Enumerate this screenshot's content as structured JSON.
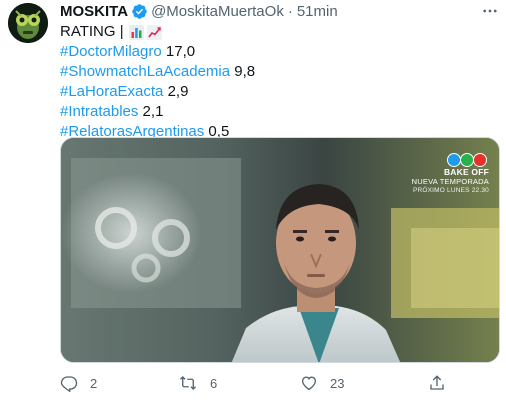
{
  "tweet": {
    "display_name": "MOSKITA",
    "handle": "@MoskitaMuertaOk",
    "separator": "·",
    "time": "51min",
    "lines": [
      {
        "hashtag": "",
        "text": "RATING |",
        "emoji": [
          "bar-chart-emoji",
          "chart-increasing-emoji"
        ]
      },
      {
        "hashtag": "#DoctorMilagro",
        "text": " 17,0"
      },
      {
        "hashtag": "#ShowmatchLaAcademia",
        "text": " 9,8"
      },
      {
        "hashtag": "#LaHoraExacta",
        "text": " 2,9"
      },
      {
        "hashtag": "#Intratables",
        "text": " 2,1"
      },
      {
        "hashtag": "#RelatorasArgentinas",
        "text": " 0,5"
      }
    ],
    "media": {
      "promo_line1": "BAKE OFF",
      "promo_line2": "NUEVA TEMPORADA",
      "promo_line3": "PRÓXIMO LUNES 22.30",
      "logo_colors": [
        "#1e9be9",
        "#27b34a",
        "#e5302b"
      ]
    },
    "actions": {
      "reply_count": "2",
      "retweet_count": "6",
      "like_count": "23"
    }
  },
  "colors": {
    "link": "#1d9bf0",
    "secondary": "#536471",
    "verified": "#1d9bf0"
  }
}
